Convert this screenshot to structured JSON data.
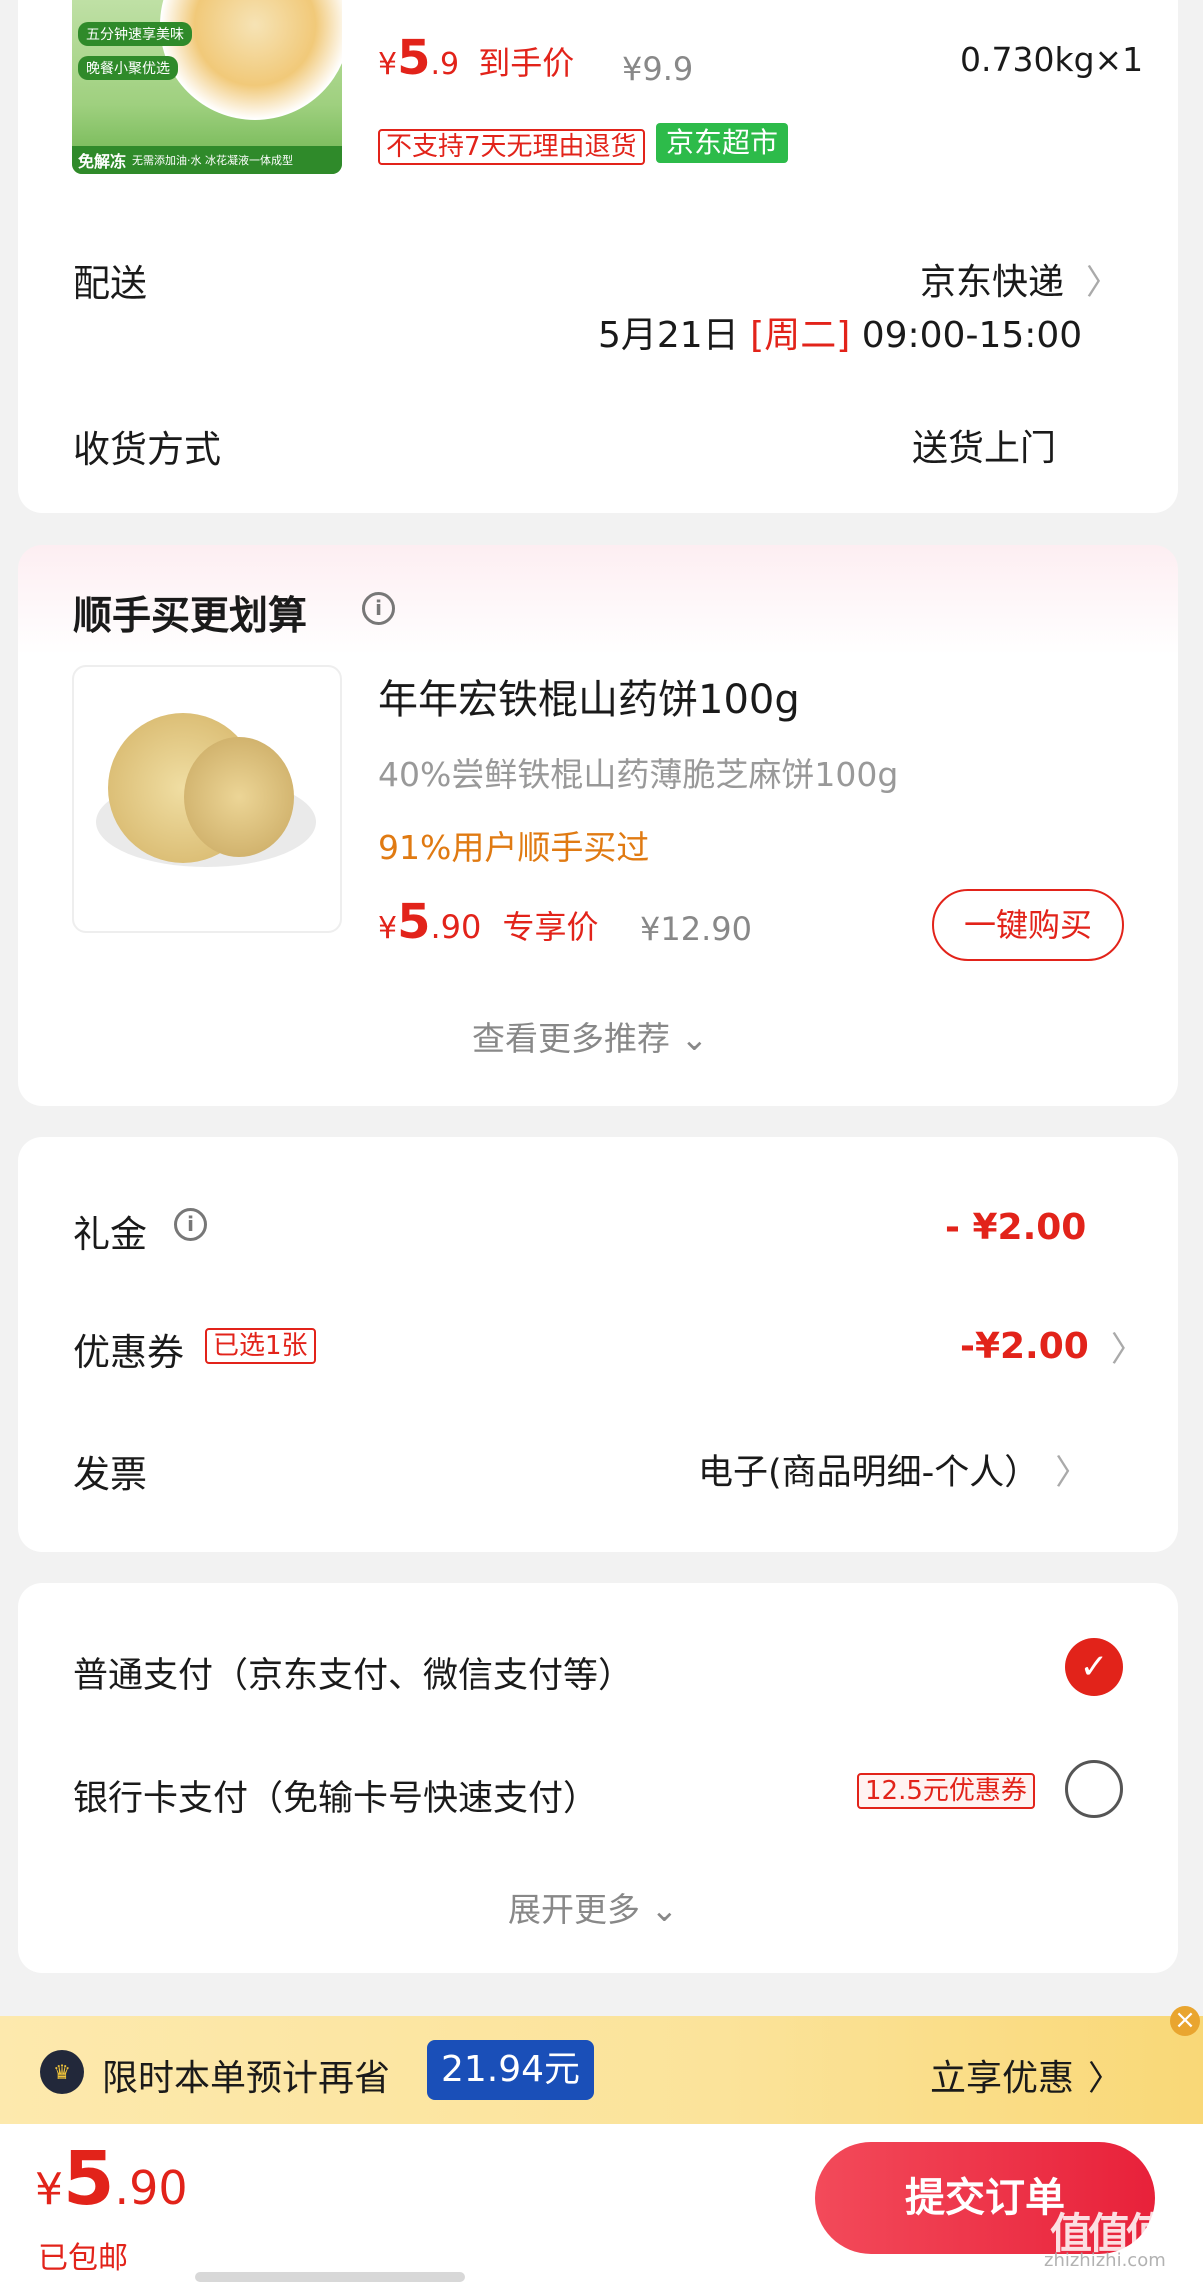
{
  "product1": {
    "thumb_banner_top": "五分钟速享美味",
    "thumb_banner_mid": "晚餐小聚优选",
    "thumb_bottom_tag": "免解冻",
    "thumb_bottom_text": "无需添加油·水 冰花凝液一体成型",
    "currency": "¥",
    "price_int": "5",
    "price_dec": ".9",
    "price_tag": "到手价",
    "orig_price": "¥9.9",
    "qty": "0.730kg×1",
    "no_return_tag": "不支持7天无理由退货",
    "store_tag": "京东超市"
  },
  "delivery": {
    "label": "配送",
    "carrier": "京东快递",
    "date": "5月21日",
    "weekday": "[周二]",
    "time": "09:00-15:00"
  },
  "receive": {
    "label": "收货方式",
    "value": "送货上门"
  },
  "addon": {
    "title": "顺手买更划算",
    "name": "年年宏铁棍山药饼100g",
    "desc": "40%尝鲜铁棍山药薄脆芝麻饼100g",
    "social": "91%用户顺手买过",
    "currency": "¥",
    "price_int": "5",
    "price_dec": ".90",
    "price_tag": "专享价",
    "orig_price": "¥12.90",
    "buy_button": "一键购买",
    "more": "查看更多推荐"
  },
  "discounts": {
    "gift_label": "礼金",
    "gift_value": "- ¥2.00",
    "coupon_label": "优惠券",
    "coupon_tag": "已选1张",
    "coupon_value": "-¥2.00",
    "invoice_label": "发票",
    "invoice_value": "电子(商品明细-个人）"
  },
  "payment": {
    "option1": "普通支付（京东支付、微信支付等）",
    "option2": "银行卡支付（免输卡号快速支付）",
    "option2_tag": "12.5元优惠券",
    "expand": "展开更多",
    "selected_option": 1
  },
  "promo_bar": {
    "text": "限时本单预计再省",
    "amount": "21.94元",
    "action": "立享优惠",
    "close": "×"
  },
  "footer": {
    "currency": "¥",
    "total_int": "5",
    "total_dec": ".90",
    "shipping": "已包邮",
    "submit": "提交订单"
  },
  "watermark": {
    "text": "值值值",
    "url": "zhizhizhi.com"
  },
  "colors": {
    "accent": "#e2231a",
    "store_green": "#2dbb4a",
    "promo_bg": "#fbe39a",
    "badge_blue": "#1a4fb8"
  }
}
